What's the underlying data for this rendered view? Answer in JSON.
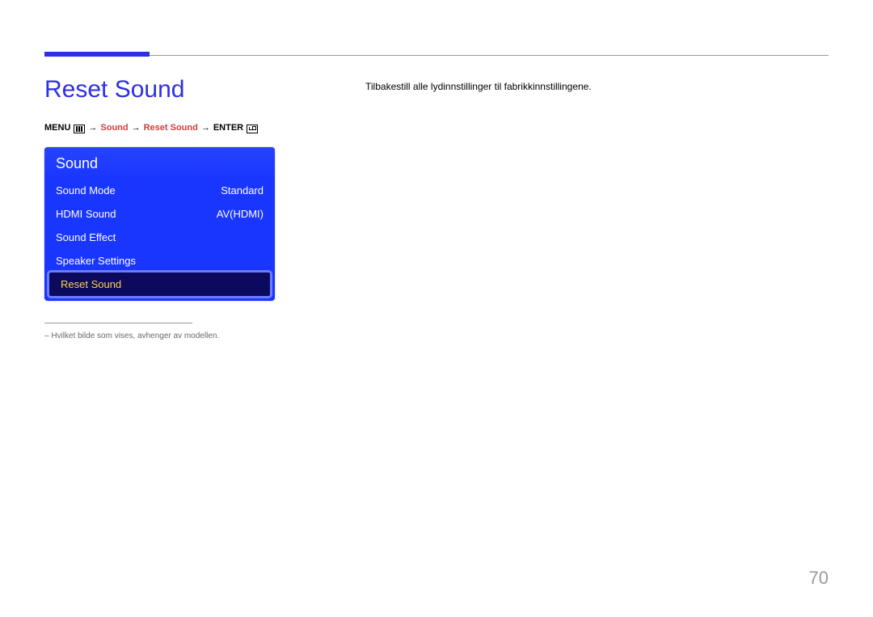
{
  "page": {
    "title": "Reset Sound",
    "number": "70"
  },
  "breadcrumb": {
    "menu": "MENU",
    "path1": "Sound",
    "path2": "Reset Sound",
    "enter": "ENTER"
  },
  "osd": {
    "title": "Sound",
    "rows": [
      {
        "label": "Sound Mode",
        "value": "Standard",
        "highlight": false
      },
      {
        "label": "HDMI Sound",
        "value": "AV(HDMI)",
        "highlight": false
      },
      {
        "label": "Sound Effect",
        "value": "",
        "highlight": false
      },
      {
        "label": "Speaker Settings",
        "value": "",
        "highlight": false
      },
      {
        "label": "Reset Sound",
        "value": "",
        "highlight": true
      }
    ]
  },
  "footnote": "–  Hvilket bilde som vises, avhenger av modellen.",
  "description": "Tilbakestill alle lydinnstillinger til fabrikkinnstillingene."
}
